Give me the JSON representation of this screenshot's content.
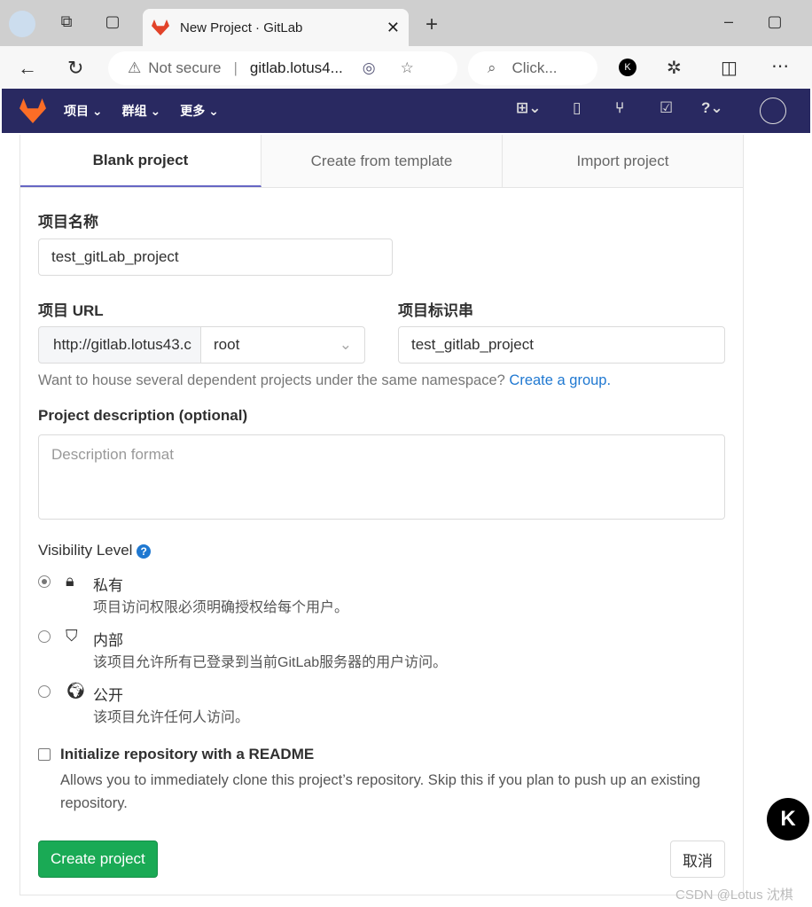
{
  "browser": {
    "tab_title": "New Project · GitLab",
    "security": "Not secure",
    "url": "gitlab.lotus4...",
    "search_placeholder": "Click..."
  },
  "nav": {
    "items": [
      "项目",
      "群组",
      "更多"
    ]
  },
  "tabs": [
    "Blank project",
    "Create from template",
    "Import project"
  ],
  "form": {
    "name_label": "项目名称",
    "name_value": "test_gitLab_project",
    "url_label": "项目 URL",
    "url_prefix": "http://gitlab.lotus43.c",
    "namespace": "root",
    "slug_label": "项目标识串",
    "slug_value": "test_gitlab_project",
    "group_hint": "Want to house several dependent projects under the same namespace?",
    "group_link": "Create a group.",
    "desc_label": "Project description (optional)",
    "desc_placeholder": "Description format",
    "visibility_label": "Visibility Level",
    "visibility": [
      {
        "title": "私有",
        "desc": "项目访问权限必须明确授权给每个用户。",
        "icon": "lock-icon",
        "selected": true
      },
      {
        "title": "内部",
        "desc": "该项目允许所有已登录到当前GitLab服务器的用户访问。",
        "icon": "shield-icon",
        "selected": false
      },
      {
        "title": "公开",
        "desc": "该项目允许任何人访问。",
        "icon": "globe-icon",
        "selected": false
      }
    ],
    "readme_label": "Initialize repository with a README",
    "readme_desc": "Allows you to immediately clone this project’s repository. Skip this if you plan to push up an existing repository.",
    "readme_checked": false,
    "create": "Create project",
    "cancel": "取消"
  },
  "watermark": "CSDN @Lotus 沈棋",
  "colors": {
    "nav": "#292961",
    "primary": "#1aaa55",
    "link": "#1f78d1"
  }
}
